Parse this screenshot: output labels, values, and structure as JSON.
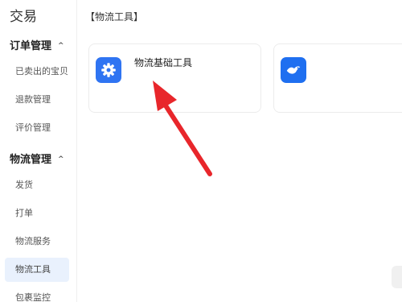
{
  "sidebar": {
    "title": "交易",
    "groups": [
      {
        "label": "订单管理",
        "caret": "^",
        "items": [
          {
            "label": "已卖出的宝贝"
          },
          {
            "label": "退款管理"
          },
          {
            "label": "评价管理"
          }
        ]
      },
      {
        "label": "物流管理",
        "caret": "^",
        "items": [
          {
            "label": "发货"
          },
          {
            "label": "打单"
          },
          {
            "label": "物流服务"
          },
          {
            "label": "物流工具",
            "active": true
          },
          {
            "label": "包裹监控"
          }
        ]
      }
    ]
  },
  "main": {
    "section_title": "【物流工具】",
    "cards": [
      {
        "label": "物流基础工具",
        "icon": "gear-icon"
      },
      {
        "label": "",
        "icon": "bird-logo-icon"
      }
    ]
  },
  "colors": {
    "accent": "#2f74f2",
    "active_bg": "#e9f1fd",
    "arrow": "#e8262b"
  }
}
